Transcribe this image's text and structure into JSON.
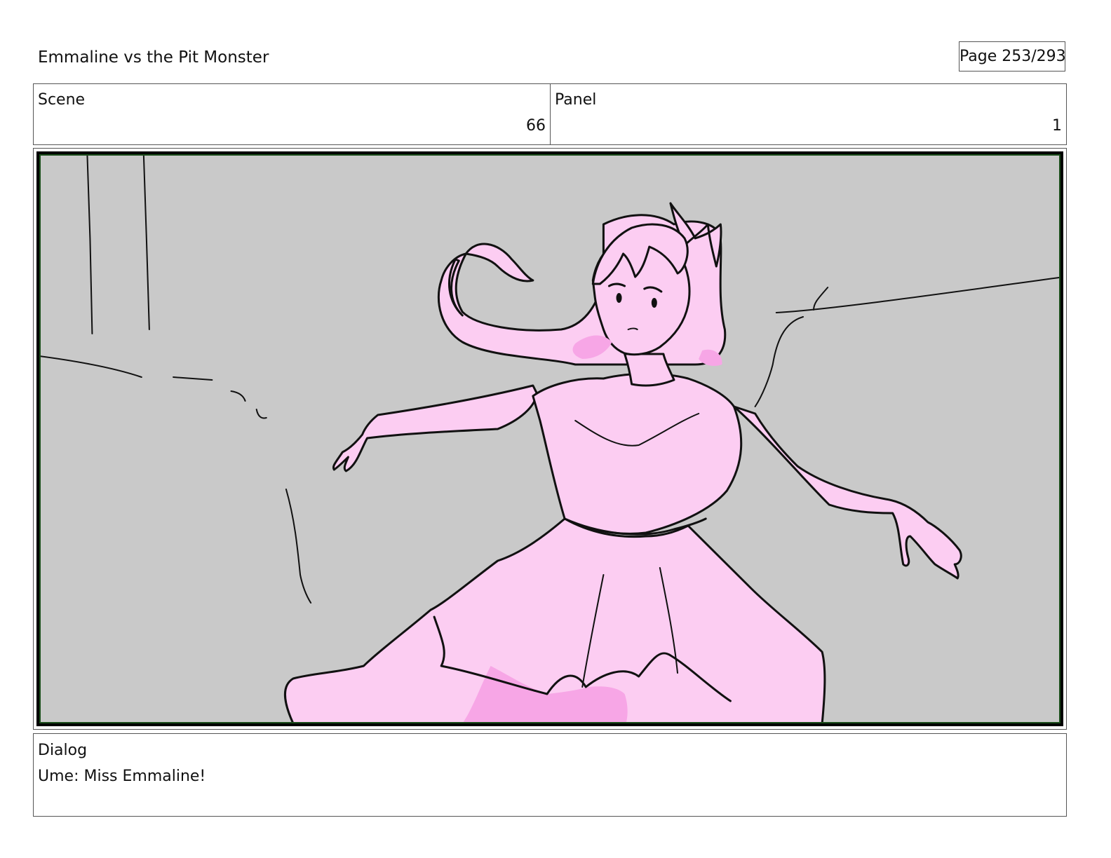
{
  "header": {
    "title": "Emmaline vs the Pit Monster",
    "page_label": "Page 253/293"
  },
  "info": {
    "scene_label": "Scene",
    "scene_value": "66",
    "panel_label": "Panel",
    "panel_value": "1"
  },
  "storyboard_panel": {
    "background_color": "#c9c9c9",
    "figure_fill": "#fccdf2",
    "shadow_fill": "#f7a6e6",
    "line_color": "#111111"
  },
  "dialog": {
    "label": "Dialog",
    "text": "Ume: Miss Emmaline!"
  }
}
